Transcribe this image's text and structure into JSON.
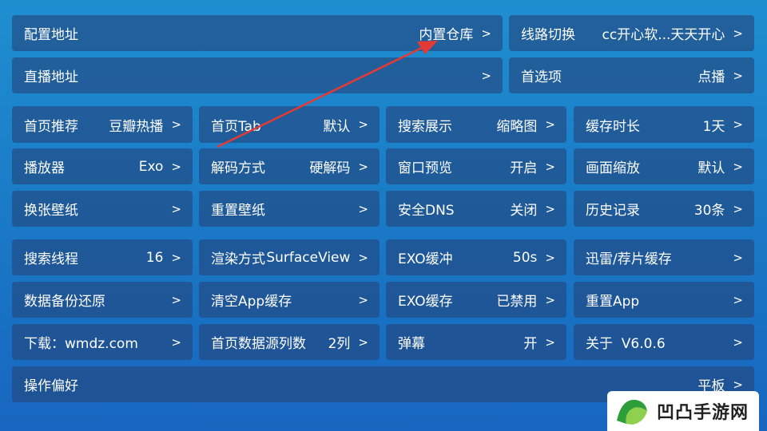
{
  "rows": {
    "r1": [
      {
        "name": "config-address",
        "label": "配置地址",
        "value": "内置仓库",
        "chev": ">"
      },
      {
        "name": "route-switch",
        "label": "线路切换",
        "value": "cc开心软...天天开心",
        "chev": ">"
      }
    ],
    "r2": [
      {
        "name": "live-address",
        "label": "直播地址",
        "value": "",
        "chev": ">"
      },
      {
        "name": "preferences",
        "label": "首选项",
        "value": "点播",
        "chev": ">"
      }
    ],
    "r3": [
      {
        "name": "home-recommend",
        "label": "首页推荐",
        "value": "豆瓣热播",
        "chev": ">"
      },
      {
        "name": "home-tab",
        "label": "首页Tab",
        "value": "默认",
        "chev": ">"
      },
      {
        "name": "search-display",
        "label": "搜索展示",
        "value": "缩略图",
        "chev": ">"
      },
      {
        "name": "cache-duration",
        "label": "缓存时长",
        "value": "1天",
        "chev": ">"
      }
    ],
    "r4": [
      {
        "name": "player",
        "label": "播放器",
        "value": "Exo",
        "chev": ">"
      },
      {
        "name": "decode-mode",
        "label": "解码方式",
        "value": "硬解码",
        "chev": ">"
      },
      {
        "name": "window-preview",
        "label": "窗口预览",
        "value": "开启",
        "chev": ">"
      },
      {
        "name": "picture-scale",
        "label": "画面缩放",
        "value": "默认",
        "chev": ">"
      }
    ],
    "r5": [
      {
        "name": "change-wallpaper",
        "label": "换张壁纸",
        "value": "",
        "chev": ">"
      },
      {
        "name": "reset-wallpaper",
        "label": "重置壁纸",
        "value": "",
        "chev": ">"
      },
      {
        "name": "secure-dns",
        "label": "安全DNS",
        "value": "关闭",
        "chev": ">"
      },
      {
        "name": "history",
        "label": "历史记录",
        "value": "30条",
        "chev": ">"
      }
    ],
    "r6": [
      {
        "name": "search-threads",
        "label": "搜索线程",
        "value": "16",
        "chev": ">"
      },
      {
        "name": "render-mode",
        "label": "渲染方式",
        "value": "SurfaceView",
        "chev": ">"
      },
      {
        "name": "exo-buffer",
        "label": "EXO缓冲",
        "value": "50s",
        "chev": ">"
      },
      {
        "name": "thunder-cache",
        "label": "迅雷/荐片缓存",
        "value": "",
        "chev": ">"
      }
    ],
    "r7": [
      {
        "name": "data-backup",
        "label": "数据备份还原",
        "value": "",
        "chev": ">"
      },
      {
        "name": "clear-app-cache",
        "label": "清空App缓存",
        "value": "",
        "chev": ">"
      },
      {
        "name": "exo-cache",
        "label": "EXO缓存",
        "value": "已禁用",
        "chev": ">"
      },
      {
        "name": "reset-app",
        "label": "重置App",
        "value": "",
        "chev": ">"
      }
    ],
    "r8": [
      {
        "name": "download",
        "label": "下载：wmdz.com",
        "value": "",
        "chev": ">"
      },
      {
        "name": "home-columns",
        "label": "首页数据源列数",
        "value": "2列",
        "chev": ">"
      },
      {
        "name": "danmaku",
        "label": "弹幕",
        "value": "开",
        "chev": ">"
      },
      {
        "name": "about",
        "label": "关于  V6.0.6",
        "value": "",
        "chev": ">"
      }
    ],
    "r9": [
      {
        "name": "operation-preference",
        "label": "操作偏好",
        "value": "平板",
        "chev": ">"
      }
    ]
  },
  "watermark": {
    "text": "凹凸手游网"
  },
  "colors": {
    "background": "#1a7cc7",
    "tile": "#23467d",
    "arrow": "#e53935",
    "text": "#ffffff"
  }
}
